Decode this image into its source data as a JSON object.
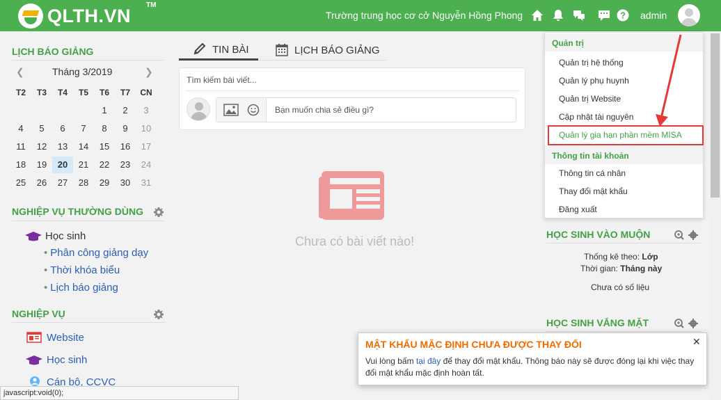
{
  "header": {
    "logo_text": "QLTH.VN",
    "logo_tm": "TM",
    "school_name": "Trường trung học cơ cở Nguyễn Hồng Phong",
    "user_name": "admin",
    "icons": [
      "home-icon",
      "bell-icon",
      "chat-icon",
      "message-icon",
      "help-icon"
    ],
    "accent_color": "#4caf50"
  },
  "calendar": {
    "title": "LỊCH BÁO GIẢNG",
    "month_label": "Tháng 3/2019",
    "prev": "❮",
    "next": "❯",
    "weekdays": [
      "T2",
      "T3",
      "T4",
      "T5",
      "T6",
      "T7",
      "CN"
    ],
    "weeks": [
      [
        "",
        "",
        "",
        "",
        "1",
        "2",
        "3"
      ],
      [
        "4",
        "5",
        "6",
        "7",
        "8",
        "9",
        "10"
      ],
      [
        "11",
        "12",
        "13",
        "14",
        "15",
        "16",
        "17"
      ],
      [
        "18",
        "19",
        "20",
        "21",
        "22",
        "23",
        "24"
      ],
      [
        "25",
        "26",
        "27",
        "28",
        "29",
        "30",
        "31"
      ]
    ],
    "today": "20"
  },
  "common_tasks": {
    "title": "NGHIỆP VỤ THƯỜNG DÙNG",
    "group_label": "Học sinh",
    "items": [
      "Phân công giảng dạy",
      "Thời khóa biểu",
      "Lịch báo giảng"
    ]
  },
  "tasks": {
    "title": "NGHIỆP VỤ",
    "items": [
      "Website",
      "Học sinh",
      "Cán bộ, CCVC"
    ]
  },
  "tabs": {
    "news": "TIN BÀI",
    "schedule": "LỊCH BÁO GIẢNG"
  },
  "post": {
    "search_placeholder": "Tìm kiếm bài viết...",
    "share_placeholder": "Bạn muốn chia sẻ điều gì?",
    "empty_text": "Chưa có bài viết nào!"
  },
  "dropdown": {
    "admin_header": "Quản trị",
    "admin_items": [
      "Quản trị hệ thống",
      "Quản lý phụ huynh",
      "Quản trị Website",
      "Cập nhật tài nguyên",
      "Quản lý gia hạn phần mềm MISA"
    ],
    "account_header": "Thông tin tài khoản",
    "account_items": [
      "Thông tin cá nhân",
      "Thay đổi mật khẩu",
      "Đăng xuất"
    ]
  },
  "late_widget": {
    "title": "HỌC SINH VÀO MUỘN",
    "stat_label": "Thống kê theo:",
    "stat_value": "Lớp",
    "time_label": "Thời gian:",
    "time_value": "Tháng này",
    "empty": "Chưa có số liệu"
  },
  "absent_widget": {
    "title": "HỌC SINH VẮNG MẶT"
  },
  "notice": {
    "title": "MẬT KHẨU MẶC ĐỊNH CHƯA ĐƯỢC THAY ĐỔI",
    "close": "✕",
    "text_before": "Vui lòng bấm",
    "link": "tại đây",
    "text_after": "để thay đổi mật khẩu. Thông báo này sẽ được đóng lại khi việc thay đổi mật khẩu mặc định hoàn tất."
  },
  "status_bar": "javascript:void(0);"
}
